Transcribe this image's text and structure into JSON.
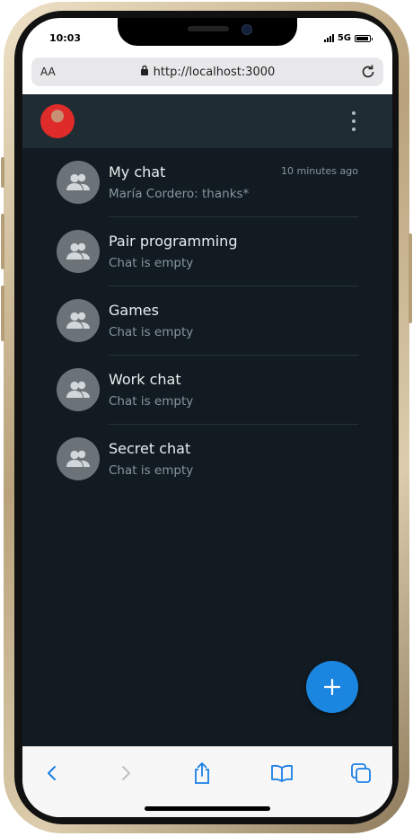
{
  "status_bar": {
    "time": "10:03",
    "network": "5G",
    "battery_level": 0.9
  },
  "browser": {
    "text_size_label": "AA",
    "url": "http://localhost:3000"
  },
  "app": {
    "accent_color": "#1b86e0",
    "chats": [
      {
        "name": "My chat",
        "last_message": "María Cordero: thanks*",
        "time": "10 minutes ago"
      },
      {
        "name": "Pair programming",
        "last_message": "Chat is empty",
        "time": ""
      },
      {
        "name": "Games",
        "last_message": "Chat is empty",
        "time": ""
      },
      {
        "name": "Work chat",
        "last_message": "Chat is empty",
        "time": ""
      },
      {
        "name": "Secret chat",
        "last_message": "Chat is empty",
        "time": ""
      }
    ]
  },
  "icons": {
    "back": "chevron-left-icon",
    "forward": "chevron-right-icon",
    "share": "share-icon",
    "bookmarks": "book-icon",
    "tabs": "tabs-icon",
    "new_chat": "plus-icon",
    "menu": "more-vertical-icon",
    "group": "group-icon",
    "lock": "lock-icon",
    "reload": "reload-icon"
  }
}
